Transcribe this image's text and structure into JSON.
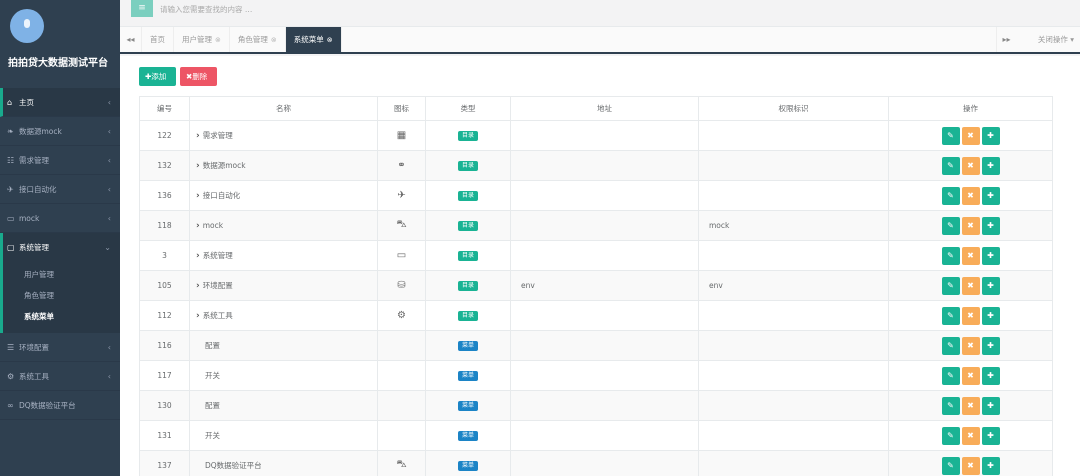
{
  "app": {
    "title": "拍拍贷大数据测试平台"
  },
  "sidebar": {
    "items": [
      {
        "icon": "home-icon",
        "glyph": "⌂",
        "label": "主页",
        "arrow": "‹"
      },
      {
        "icon": "binoculars-icon",
        "glyph": "❧",
        "label": "数据源mock",
        "arrow": "‹"
      },
      {
        "icon": "calendar-icon",
        "glyph": "☷",
        "label": "需求管理",
        "arrow": "‹"
      },
      {
        "icon": "plane-icon",
        "glyph": "✈",
        "label": "接口自动化",
        "arrow": "‹"
      },
      {
        "icon": "car-icon",
        "glyph": "▭",
        "label": "mock",
        "arrow": "‹"
      },
      {
        "icon": "desktop-icon",
        "glyph": "▢",
        "label": "系统管理",
        "arrow": "⌄"
      }
    ],
    "submenu": [
      {
        "label": "用户管理"
      },
      {
        "label": "角色管理"
      },
      {
        "label": "系统菜单"
      }
    ],
    "items_after": [
      {
        "icon": "database-icon",
        "glyph": "☰",
        "label": "环境配置",
        "arrow": "‹"
      },
      {
        "icon": "gear-icon",
        "glyph": "⚙",
        "label": "系统工具",
        "arrow": "‹"
      },
      {
        "icon": "link-icon",
        "glyph": "∞",
        "label": "DQ数据验证平台",
        "arrow": ""
      }
    ]
  },
  "topbar": {
    "toggle_glyph": "≡",
    "search_placeholder": "请输入您需要查找的内容 …"
  },
  "tabs": {
    "nav_left": "◂◂",
    "nav_right": "▸▸",
    "close_ops": "关闭操作 ▾",
    "items": [
      {
        "label": "首页",
        "close": ""
      },
      {
        "label": "用户管理",
        "close": "⊗"
      },
      {
        "label": "角色管理",
        "close": "⊗"
      },
      {
        "label": "系统菜单",
        "close": "⊗"
      }
    ]
  },
  "toolbar": {
    "add_label": "✚添加",
    "delete_label": "✖删除"
  },
  "table": {
    "headers": [
      "编号",
      "名称",
      "图标",
      "类型",
      "地址",
      "权限标识",
      "操作"
    ],
    "rows": [
      {
        "id": "122",
        "name": "需求管理",
        "expand": true,
        "icon": "calendar-icon",
        "icon_glyph": "▦",
        "type": "目录",
        "type_kind": "dir",
        "address": "",
        "perm": ""
      },
      {
        "id": "132",
        "name": "数据源mock",
        "expand": true,
        "icon": "binoculars-icon",
        "icon_glyph": "⚭",
        "type": "目录",
        "type_kind": "dir",
        "address": "",
        "perm": ""
      },
      {
        "id": "136",
        "name": "接口自动化",
        "expand": true,
        "icon": "plane-icon",
        "icon_glyph": "✈",
        "type": "目录",
        "type_kind": "dir",
        "address": "",
        "perm": ""
      },
      {
        "id": "118",
        "name": "mock",
        "expand": true,
        "icon": "car-icon",
        "icon_glyph": "⛍",
        "type": "目录",
        "type_kind": "dir",
        "address": "",
        "perm": "mock"
      },
      {
        "id": "3",
        "name": "系统管理",
        "expand": true,
        "icon": "desktop-icon",
        "icon_glyph": "▭",
        "type": "目录",
        "type_kind": "dir",
        "address": "",
        "perm": ""
      },
      {
        "id": "105",
        "name": "环境配置",
        "expand": true,
        "icon": "database-icon",
        "icon_glyph": "⛁",
        "type": "目录",
        "type_kind": "dir",
        "address": "env",
        "perm": "env"
      },
      {
        "id": "112",
        "name": "系统工具",
        "expand": true,
        "icon": "gear-icon",
        "icon_glyph": "⚙",
        "type": "目录",
        "type_kind": "dir",
        "address": "",
        "perm": ""
      },
      {
        "id": "116",
        "name": "配置",
        "expand": false,
        "icon": "",
        "icon_glyph": "",
        "type": "菜单",
        "type_kind": "menu",
        "address": "",
        "perm": ""
      },
      {
        "id": "117",
        "name": "开关",
        "expand": false,
        "icon": "",
        "icon_glyph": "",
        "type": "菜单",
        "type_kind": "menu",
        "address": "",
        "perm": ""
      },
      {
        "id": "130",
        "name": "配置",
        "expand": false,
        "icon": "",
        "icon_glyph": "",
        "type": "菜单",
        "type_kind": "menu",
        "address": "",
        "perm": ""
      },
      {
        "id": "131",
        "name": "开关",
        "expand": false,
        "icon": "",
        "icon_glyph": "",
        "type": "菜单",
        "type_kind": "menu",
        "address": "",
        "perm": ""
      },
      {
        "id": "137",
        "name": "DQ数据验证平台",
        "expand": false,
        "icon": "car-icon",
        "icon_glyph": "⛍",
        "type": "菜单",
        "type_kind": "menu",
        "address": "",
        "perm": ""
      }
    ],
    "op_labels": {
      "edit": "✎",
      "delete": "✖",
      "add": "✚"
    }
  },
  "colors": {
    "sidebar": "#2f4050",
    "primary": "#1ab394",
    "danger": "#ed5565",
    "warning": "#f8ac59",
    "info": "#1c84c6"
  }
}
